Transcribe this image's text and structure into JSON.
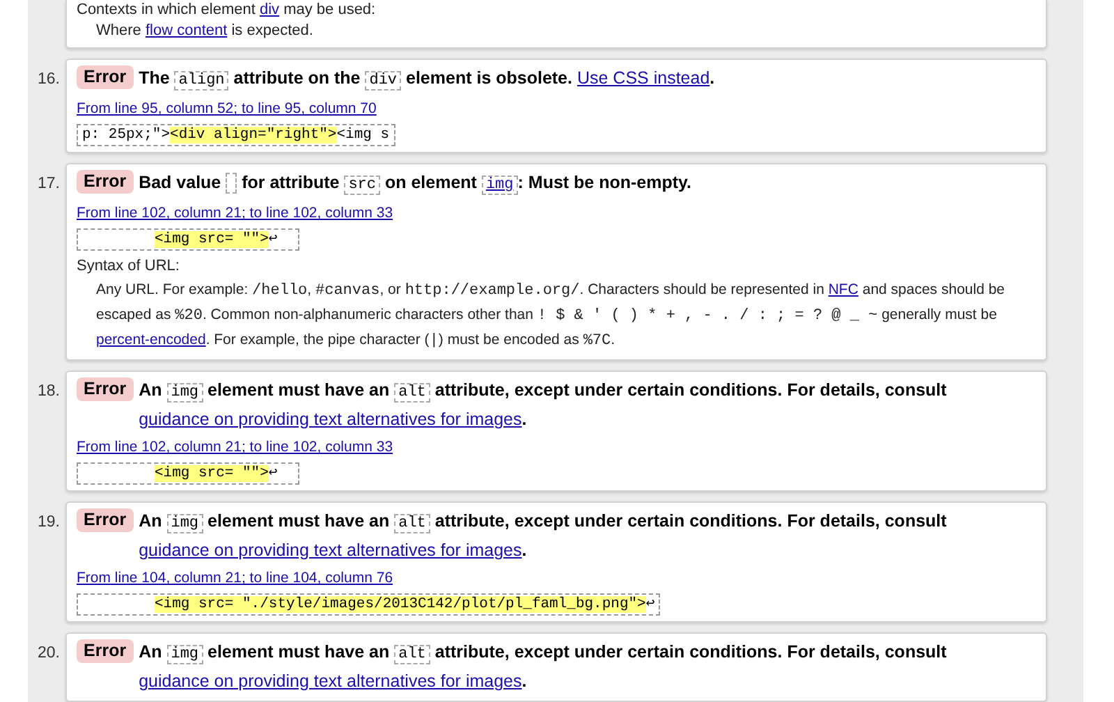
{
  "top_partial": {
    "contexts": [
      {
        "kind": "text",
        "text": "Contexts in which element "
      },
      {
        "kind": "link",
        "text": "div"
      },
      {
        "kind": "text",
        "text": " may be used:"
      }
    ],
    "where": [
      {
        "kind": "text",
        "text": "Where "
      },
      {
        "kind": "link",
        "text": "flow content"
      },
      {
        "kind": "text",
        "text": " is expected."
      }
    ]
  },
  "messages": [
    {
      "number": "16.",
      "type": "Error",
      "segments": [
        {
          "kind": "text",
          "text": "The "
        },
        {
          "kind": "code",
          "text": "align"
        },
        {
          "kind": "text",
          "text": " attribute on the "
        },
        {
          "kind": "code",
          "text": "div"
        },
        {
          "kind": "text",
          "text": " element is obsolete. "
        },
        {
          "kind": "link",
          "text": "Use CSS instead"
        },
        {
          "kind": "text",
          "text": "."
        }
      ],
      "location": "From line 95, column 52; to line 95, column 70",
      "extract": [
        {
          "kind": "plain",
          "text": "p: 25px;\">"
        },
        {
          "kind": "highlight",
          "text": "<div align=\"right\">"
        },
        {
          "kind": "plain",
          "text": "<img s"
        }
      ]
    },
    {
      "number": "17.",
      "type": "Error",
      "segments": [
        {
          "kind": "text",
          "text": "Bad value "
        },
        {
          "kind": "empty_code"
        },
        {
          "kind": "text",
          "text": " for attribute "
        },
        {
          "kind": "code",
          "text": "src"
        },
        {
          "kind": "text",
          "text": " on element "
        },
        {
          "kind": "code_link",
          "text": "img"
        },
        {
          "kind": "text",
          "text": ": Must be non-empty."
        }
      ],
      "location": "From line 102, column 21; to line 102, column 33",
      "extract": [
        {
          "kind": "highlight",
          "text": "<img src= \"\">"
        },
        {
          "kind": "plain",
          "text": "↩"
        }
      ],
      "details": {
        "heading": "Syntax of URL:",
        "segments": [
          {
            "kind": "text",
            "text": "Any URL. For example: "
          },
          {
            "kind": "code",
            "text": "/hello"
          },
          {
            "kind": "text",
            "text": ", "
          },
          {
            "kind": "code",
            "text": "#canvas"
          },
          {
            "kind": "text",
            "text": ", or "
          },
          {
            "kind": "code",
            "text": "http://example.org/"
          },
          {
            "kind": "text",
            "text": ". Characters should be represented in "
          },
          {
            "kind": "link",
            "text": "NFC"
          },
          {
            "kind": "text",
            "text": " and spaces should be escaped as "
          },
          {
            "kind": "code",
            "text": "%20"
          },
          {
            "kind": "text",
            "text": ". Common non-alphanumeric characters other than "
          },
          {
            "kind": "code",
            "text": "! $ & ' ( ) * + , - . / : ; = ? @ _ ~"
          },
          {
            "kind": "text",
            "text": " generally must be "
          },
          {
            "kind": "link",
            "text": "percent-encoded"
          },
          {
            "kind": "text",
            "text": ". For example, the pipe character ("
          },
          {
            "kind": "code",
            "text": "|"
          },
          {
            "kind": "text",
            "text": ") must be encoded as "
          },
          {
            "kind": "code",
            "text": "%7C"
          },
          {
            "kind": "text",
            "text": "."
          }
        ]
      }
    },
    {
      "number": "18.",
      "type": "Error",
      "segments": [
        {
          "kind": "text",
          "text": "An "
        },
        {
          "kind": "code",
          "text": "img"
        },
        {
          "kind": "text",
          "text": " element must have an "
        },
        {
          "kind": "code",
          "text": "alt"
        },
        {
          "kind": "text",
          "text": " attribute, except under certain conditions. For details, consult "
        },
        {
          "kind": "link",
          "text": "guidance on providing text alternatives for images"
        },
        {
          "kind": "text",
          "text": "."
        }
      ],
      "location": "From line 102, column 21; to line 102, column 33",
      "extract": [
        {
          "kind": "highlight",
          "text": "<img src= \"\">"
        },
        {
          "kind": "plain",
          "text": "↩"
        }
      ]
    },
    {
      "number": "19.",
      "type": "Error",
      "segments": [
        {
          "kind": "text",
          "text": "An "
        },
        {
          "kind": "code",
          "text": "img"
        },
        {
          "kind": "text",
          "text": " element must have an "
        },
        {
          "kind": "code",
          "text": "alt"
        },
        {
          "kind": "text",
          "text": " attribute, except under certain conditions. For details, consult "
        },
        {
          "kind": "link",
          "text": "guidance on providing text alternatives for images"
        },
        {
          "kind": "text",
          "text": "."
        }
      ],
      "location": "From line 104, column 21; to line 104, column 76",
      "extract": [
        {
          "kind": "highlight",
          "text": "<img src= \"./style/images/2013C142/plot/pl_faml_bg.png\">"
        },
        {
          "kind": "plain",
          "text": "↩"
        }
      ]
    },
    {
      "number": "20.",
      "type": "Error",
      "segments": [
        {
          "kind": "text",
          "text": "An "
        },
        {
          "kind": "code",
          "text": "img"
        },
        {
          "kind": "text",
          "text": " element must have an "
        },
        {
          "kind": "code",
          "text": "alt"
        },
        {
          "kind": "text",
          "text": " attribute, except under certain conditions. For details, consult "
        },
        {
          "kind": "link",
          "text": "guidance on providing text alternatives for images"
        },
        {
          "kind": "text",
          "text": "."
        }
      ]
    }
  ]
}
